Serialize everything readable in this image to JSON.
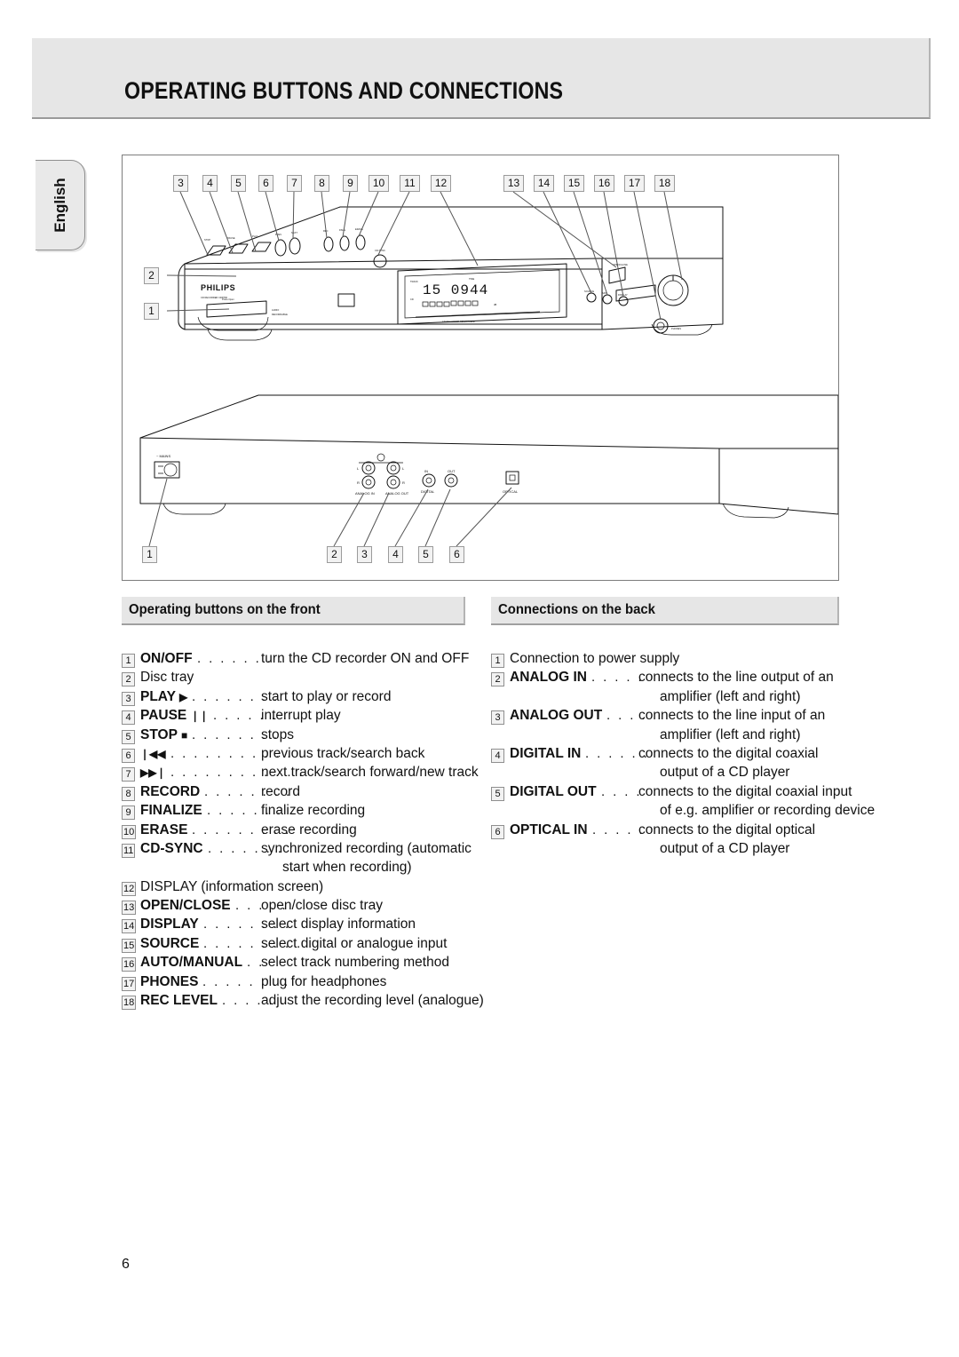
{
  "header": {
    "title": "OPERATING BUTTONS AND CONNECTIONS"
  },
  "language_tab": {
    "label": "English"
  },
  "page_number": "6",
  "figure": {
    "front_view": {
      "brand": "PHILIPS",
      "model_line": "CD RECORDER CDR760",
      "tray_label": "Press Open",
      "disc_badge": "Compact Disc",
      "display_text": "15   0944",
      "top_callouts": [
        "3",
        "4",
        "5",
        "6",
        "7",
        "8",
        "9",
        "10",
        "11",
        "12",
        "13",
        "14",
        "15",
        "16",
        "17",
        "18"
      ],
      "left_callouts": [
        "2",
        "1"
      ]
    },
    "back_view": {
      "mains_label": "MAINS",
      "jack_labels": [
        "L",
        "L",
        "R",
        "R"
      ],
      "group_labels": [
        "ANALOG IN",
        "ANALOG OUT",
        "DIGITAL",
        "OPTICAL"
      ],
      "bottom_callouts": [
        "1",
        "2",
        "3",
        "4",
        "5",
        "6"
      ]
    }
  },
  "sections": {
    "front": {
      "heading": "Operating buttons on the front",
      "items": [
        {
          "num": "1",
          "label": "ON/OFF",
          "bold": true,
          "glyph": "",
          "dots": ". . . . . . . .",
          "desc": "turn the CD recorder ON and OFF",
          "cont": ""
        },
        {
          "num": "2",
          "label": "Disc tray",
          "bold": false,
          "glyph": "",
          "dots": "",
          "desc": "",
          "cont": ""
        },
        {
          "num": "3",
          "label": "PLAY",
          "bold": true,
          "glyph": "▶",
          "dots": ". . . . . . . .",
          "desc": "start to play or record",
          "cont": ""
        },
        {
          "num": "4",
          "label": "PAUSE",
          "bold": true,
          "glyph": "❘❘",
          "dots": ". . . . . . .",
          "desc": "interrupt play",
          "cont": ""
        },
        {
          "num": "5",
          "label": "STOP",
          "bold": true,
          "glyph": "■",
          "dots": ". . . . . . . .",
          "desc": "stops",
          "cont": ""
        },
        {
          "num": "6",
          "label": "",
          "bold": true,
          "glyph": "❘◀◀",
          "dots": ". . . . . . . . . . . .",
          "desc": "previous track/search back",
          "cont": ""
        },
        {
          "num": "7",
          "label": "",
          "bold": true,
          "glyph": "▶▶❘",
          "dots": ". . . . . . . . . . . .",
          "desc": "next track/search forward/new track",
          "cont": ""
        },
        {
          "num": "8",
          "label": "RECORD",
          "bold": true,
          "glyph": "",
          "dots": ". . . . . . . .",
          "desc": "record",
          "cont": ""
        },
        {
          "num": "9",
          "label": "FINALIZE",
          "bold": true,
          "glyph": "",
          "dots": ". . . . . . .",
          "desc": "finalize recording",
          "cont": ""
        },
        {
          "num": "10",
          "label": "ERASE",
          "bold": true,
          "glyph": "",
          "dots": ". . . . . . . . .",
          "desc": "erase recording",
          "cont": ""
        },
        {
          "num": "11",
          "label": "CD-SYNC",
          "bold": true,
          "glyph": "",
          "dots": ". . . . . . .",
          "desc": "synchronized recording (automatic",
          "cont": "start when recording)"
        },
        {
          "num": "12",
          "label": "DISPLAY (information screen)",
          "bold": false,
          "glyph": "",
          "dots": "",
          "desc": "",
          "cont": ""
        },
        {
          "num": "13",
          "label": "OPEN/CLOSE",
          "bold": true,
          "glyph": "",
          "dots": ". . . . .",
          "desc": "open/close disc tray",
          "cont": ""
        },
        {
          "num": "14",
          "label": "DISPLAY",
          "bold": true,
          "glyph": "",
          "dots": ". . . . . . . .",
          "desc": "select display information",
          "cont": ""
        },
        {
          "num": "15",
          "label": "SOURCE",
          "bold": true,
          "glyph": "",
          "dots": ". . . . . . . . .",
          "desc": "select digital or analogue input",
          "cont": ""
        },
        {
          "num": "16",
          "label": "AUTO/MANUAL",
          "bold": true,
          "glyph": "",
          "dots": ". .",
          "desc": "select track numbering method",
          "cont": ""
        },
        {
          "num": "17",
          "label": "PHONES",
          "bold": true,
          "glyph": "",
          "dots": ". . . . . . . .",
          "desc": "plug for headphones",
          "cont": ""
        },
        {
          "num": "18",
          "label": "REC LEVEL",
          "bold": true,
          "glyph": "",
          "dots": ". . . . . .",
          "desc": "adjust the recording level (analogue)",
          "cont": ""
        }
      ]
    },
    "back": {
      "heading": "Connections on the back",
      "items": [
        {
          "num": "1",
          "label": "Connection to power supply",
          "bold": false,
          "dots": "",
          "desc": "",
          "cont": ""
        },
        {
          "num": "2",
          "label": "ANALOG IN",
          "bold": true,
          "dots": ". . . . .",
          "desc": "connects to the line output of an",
          "cont": "amplifier (left and right)"
        },
        {
          "num": "3",
          "label": "ANALOG OUT",
          "bold": true,
          "dots": ". . . .",
          "desc": "connects to the line input of an",
          "cont": "amplifier (left and right)"
        },
        {
          "num": "4",
          "label": "DIGITAL IN",
          "bold": true,
          "dots": ". . . . . .",
          "desc": "connects to the digital coaxial",
          "cont": "output of a CD player"
        },
        {
          "num": "5",
          "label": "DIGITAL OUT",
          "bold": true,
          "dots": ". . . .",
          "desc": "connects to the digital coaxial input",
          "cont": "of e.g. amplifier or recording device"
        },
        {
          "num": "6",
          "label": "OPTICAL IN",
          "bold": true,
          "dots": ". . . . .",
          "desc": "connects to the digital optical",
          "cont": "output of a CD player"
        }
      ]
    }
  },
  "colors": {
    "band": "#e6e6e6",
    "border": "#7d7d7d",
    "text": "#111111"
  }
}
